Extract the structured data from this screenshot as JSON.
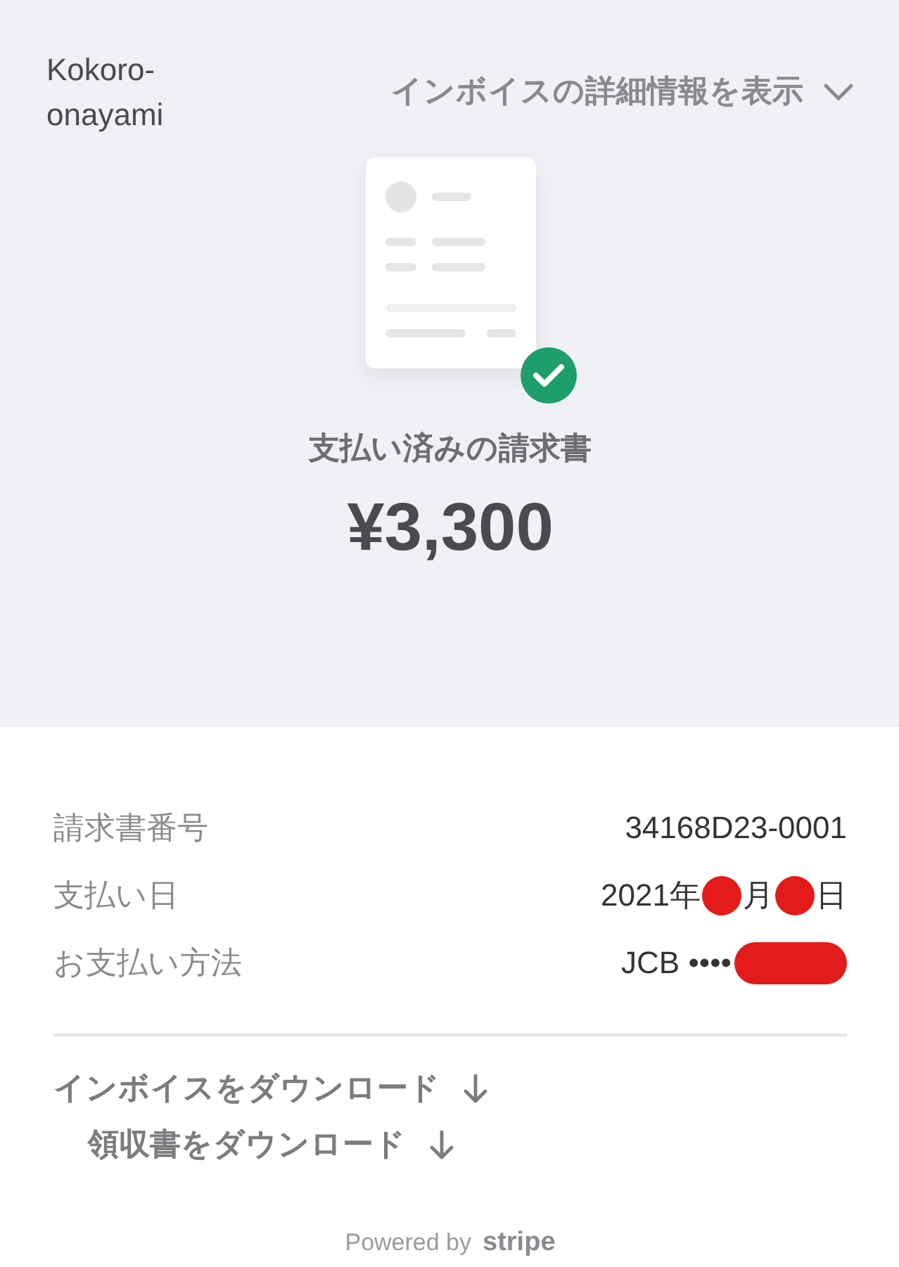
{
  "merchant": "Kokoro-onayami",
  "details_toggle": {
    "label": "インボイスの詳細情報を表示",
    "expanded": false
  },
  "status": {
    "label": "支払い済みの請求書",
    "paid": true
  },
  "amount": "¥3,300",
  "details": [
    {
      "label": "請求書番号",
      "value": [
        {
          "kind": "text",
          "text": "34168D23-0001"
        }
      ]
    },
    {
      "label": "支払い日",
      "value": [
        {
          "kind": "text",
          "text": "2021年"
        },
        {
          "kind": "dot"
        },
        {
          "kind": "text",
          "text": "月"
        },
        {
          "kind": "dot"
        },
        {
          "kind": "text",
          "text": "日"
        }
      ]
    },
    {
      "label": "お支払い方法",
      "value": [
        {
          "kind": "text",
          "text": "JCB ••••"
        },
        {
          "kind": "bar"
        }
      ]
    }
  ],
  "downloads": [
    {
      "label": "インボイスをダウンロード"
    },
    {
      "label": "領収書をダウンロード"
    }
  ],
  "footer": {
    "prefix": "Powered by",
    "brand": "stripe"
  }
}
